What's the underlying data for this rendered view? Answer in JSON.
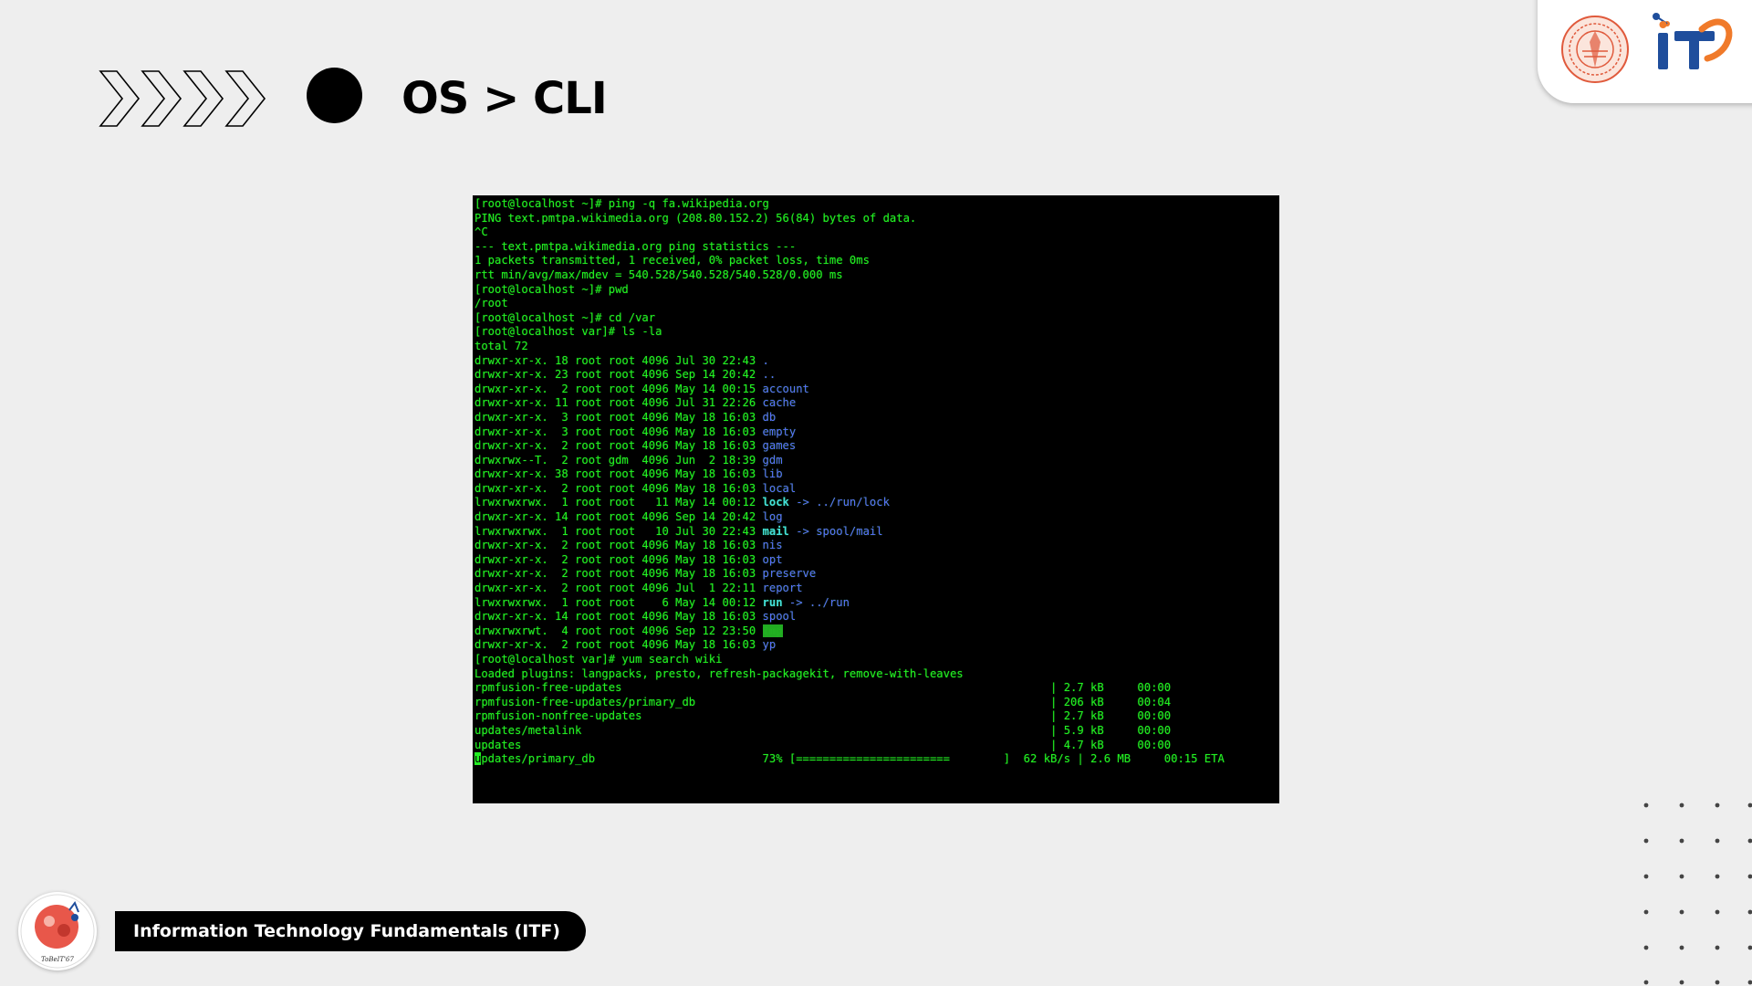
{
  "slide": {
    "title": "OS > CLI",
    "footer_text": "Information Technology Fundamentals (ITF)",
    "footer_logo_caption": "ToBeIT'67"
  },
  "icons": {
    "chevrons": "double-chevron-right-icon",
    "bullet": "black-circle-bullet",
    "seal": "university-seal-logo",
    "it_logo": "it-faculty-logo",
    "footer_logo": "tobeit-mascot-logo",
    "dot_grid": "decorative-dot-grid"
  },
  "colors": {
    "background": "#eeeeee",
    "terminal_bg": "#000000",
    "terminal_text": "#22ee22",
    "dir_blue": "#5b6bff",
    "link_cyan": "#44dddd",
    "it_blue": "#1f4e9c",
    "it_orange": "#f07a2a",
    "seal_red": "#e05a3c"
  },
  "terminal": {
    "lines": [
      [
        {
          "t": "[root@localhost ~]# ping -q fa.wikipedia.org"
        }
      ],
      [
        {
          "t": "PING text.pmtpa.wikimedia.org (208.80.152.2) 56(84) bytes of data."
        }
      ],
      [
        {
          "t": "^C"
        }
      ],
      [
        {
          "t": "--- text.pmtpa.wikimedia.org ping statistics ---"
        }
      ],
      [
        {
          "t": "1 packets transmitted, 1 received, 0% packet loss, time 0ms"
        }
      ],
      [
        {
          "t": "rtt min/avg/max/mdev = 540.528/540.528/540.528/0.000 ms"
        }
      ],
      [
        {
          "t": "[root@localhost ~]# pwd"
        }
      ],
      [
        {
          "t": "/root"
        }
      ],
      [
        {
          "t": "[root@localhost ~]# cd /var"
        }
      ],
      [
        {
          "t": "[root@localhost var]# ls -la"
        }
      ],
      [
        {
          "t": "total 72"
        }
      ],
      [
        {
          "t": "drwxr-xr-x. 18 root root 4096 Jul 30 22:43 "
        },
        {
          "t": ".",
          "c": "blue"
        }
      ],
      [
        {
          "t": "drwxr-xr-x. 23 root root 4096 Sep 14 20:42 "
        },
        {
          "t": "..",
          "c": "blue"
        }
      ],
      [
        {
          "t": "drwxr-xr-x.  2 root root 4096 May 14 00:15 "
        },
        {
          "t": "account",
          "c": "blue"
        }
      ],
      [
        {
          "t": "drwxr-xr-x. 11 root root 4096 Jul 31 22:26 "
        },
        {
          "t": "cache",
          "c": "blue"
        }
      ],
      [
        {
          "t": "drwxr-xr-x.  3 root root 4096 May 18 16:03 "
        },
        {
          "t": "db",
          "c": "blue"
        }
      ],
      [
        {
          "t": "drwxr-xr-x.  3 root root 4096 May 18 16:03 "
        },
        {
          "t": "empty",
          "c": "blue"
        }
      ],
      [
        {
          "t": "drwxr-xr-x.  2 root root 4096 May 18 16:03 "
        },
        {
          "t": "games",
          "c": "blue"
        }
      ],
      [
        {
          "t": "drwxrwx--T.  2 root gdm  4096 Jun  2 18:39 "
        },
        {
          "t": "gdm",
          "c": "blue"
        }
      ],
      [
        {
          "t": "drwxr-xr-x. 38 root root 4096 May 18 16:03 "
        },
        {
          "t": "lib",
          "c": "blue"
        }
      ],
      [
        {
          "t": "drwxr-xr-x.  2 root root 4096 May 18 16:03 "
        },
        {
          "t": "local",
          "c": "blue"
        }
      ],
      [
        {
          "t": "lrwxrwxrwx.  1 root root   11 May 14 00:12 "
        },
        {
          "t": "lock",
          "c": "cyan"
        },
        {
          "t": " -> ../run/lock",
          "c": "blue"
        }
      ],
      [
        {
          "t": "drwxr-xr-x. 14 root root 4096 Sep 14 20:42 "
        },
        {
          "t": "log",
          "c": "blue"
        }
      ],
      [
        {
          "t": "lrwxrwxrwx.  1 root root   10 Jul 30 22:43 "
        },
        {
          "t": "mail",
          "c": "cyan"
        },
        {
          "t": " -> spool/mail",
          "c": "blue"
        }
      ],
      [
        {
          "t": "drwxr-xr-x.  2 root root 4096 May 18 16:03 "
        },
        {
          "t": "nis",
          "c": "blue"
        }
      ],
      [
        {
          "t": "drwxr-xr-x.  2 root root 4096 May 18 16:03 "
        },
        {
          "t": "opt",
          "c": "blue"
        }
      ],
      [
        {
          "t": "drwxr-xr-x.  2 root root 4096 May 18 16:03 "
        },
        {
          "t": "preserve",
          "c": "blue"
        }
      ],
      [
        {
          "t": "drwxr-xr-x.  2 root root 4096 Jul  1 22:11 "
        },
        {
          "t": "report",
          "c": "blue"
        }
      ],
      [
        {
          "t": "lrwxrwxrwx.  1 root root    6 May 14 00:12 "
        },
        {
          "t": "run",
          "c": "cyan"
        },
        {
          "t": " -> ../run",
          "c": "blue"
        }
      ],
      [
        {
          "t": "drwxr-xr-x. 14 root root 4096 May 18 16:03 "
        },
        {
          "t": "spool",
          "c": "blue"
        }
      ],
      [
        {
          "t": "drwxrwxrwt.  4 root root 4096 Sep 12 23:50 "
        },
        {
          "t": "tmp",
          "c": "hl"
        }
      ],
      [
        {
          "t": "drwxr-xr-x.  2 root root 4096 May 18 16:03 "
        },
        {
          "t": "yp",
          "c": "blue"
        }
      ],
      [
        {
          "t": "[root@localhost var]# yum search wiki"
        }
      ],
      [
        {
          "t": "Loaded plugins: langpacks, presto, refresh-packagekit, remove-with-leaves"
        }
      ],
      [
        {
          "t": "rpmfusion-free-updates                                                                | 2.7 kB     00:00"
        }
      ],
      [
        {
          "t": "rpmfusion-free-updates/primary_db                                                     | 206 kB     00:04"
        }
      ],
      [
        {
          "t": "rpmfusion-nonfree-updates                                                             | 2.7 kB     00:00"
        }
      ],
      [
        {
          "t": "updates/metalink                                                                      | 5.9 kB     00:00"
        }
      ],
      [
        {
          "t": "updates                                                                               | 4.7 kB     00:00"
        }
      ],
      [
        {
          "t": "u",
          "c": "cursor"
        },
        {
          "t": "pdates/primary_db                         73% [=======================        ]  62 kB/s | 2.6 MB     00:15 ETA"
        }
      ]
    ]
  }
}
